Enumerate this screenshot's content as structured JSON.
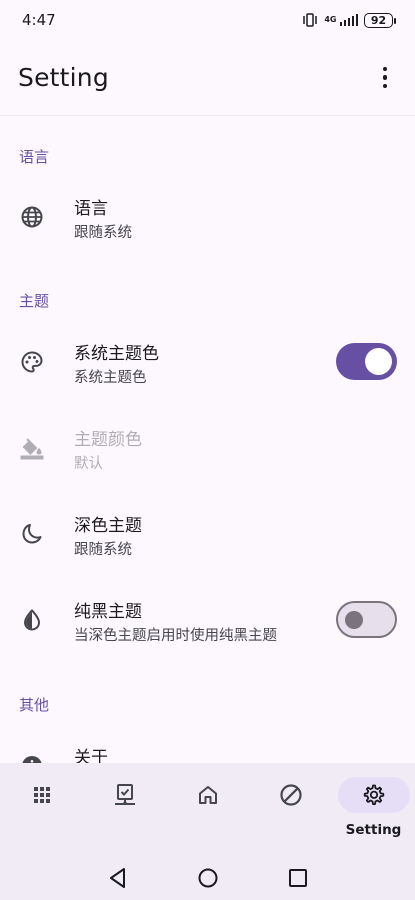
{
  "status_bar": {
    "time": "4:47",
    "network": "4G",
    "battery": "92"
  },
  "app_bar": {
    "title": "Setting",
    "more_icon": "more-vert-icon"
  },
  "sections": {
    "language": {
      "header": "语言",
      "items": [
        {
          "title": "语言",
          "subtitle": "跟随系统",
          "icon": "globe-icon"
        }
      ]
    },
    "theme": {
      "header": "主题",
      "items": [
        {
          "title": "系统主题色",
          "subtitle": "系统主题色",
          "icon": "palette-icon",
          "toggle": true
        },
        {
          "title": "主题颜色",
          "subtitle": "默认",
          "icon": "format-color-fill-icon",
          "disabled": true
        },
        {
          "title": "深色主题",
          "subtitle": "跟随系统",
          "icon": "dark-mode-icon"
        },
        {
          "title": "纯黑主题",
          "subtitle": "当深色主题启用时使用纯黑主题",
          "icon": "contrast-icon",
          "toggle": false
        }
      ]
    },
    "other": {
      "header": "其他",
      "items": [
        {
          "title": "关于",
          "icon": "info-icon"
        }
      ]
    }
  },
  "bottom_nav": {
    "items": [
      {
        "icon": "apps-grid-icon",
        "label": ""
      },
      {
        "icon": "task-board-icon",
        "label": ""
      },
      {
        "icon": "home-icon",
        "label": ""
      },
      {
        "icon": "block-icon",
        "label": ""
      },
      {
        "icon": "settings-gear-icon",
        "label": "Setting",
        "active": true
      }
    ]
  },
  "colors": {
    "accent": "#6750a4",
    "background": "#fdf8fd",
    "nav_background": "#f0ebf4",
    "active_pill": "#e6ddf6"
  }
}
